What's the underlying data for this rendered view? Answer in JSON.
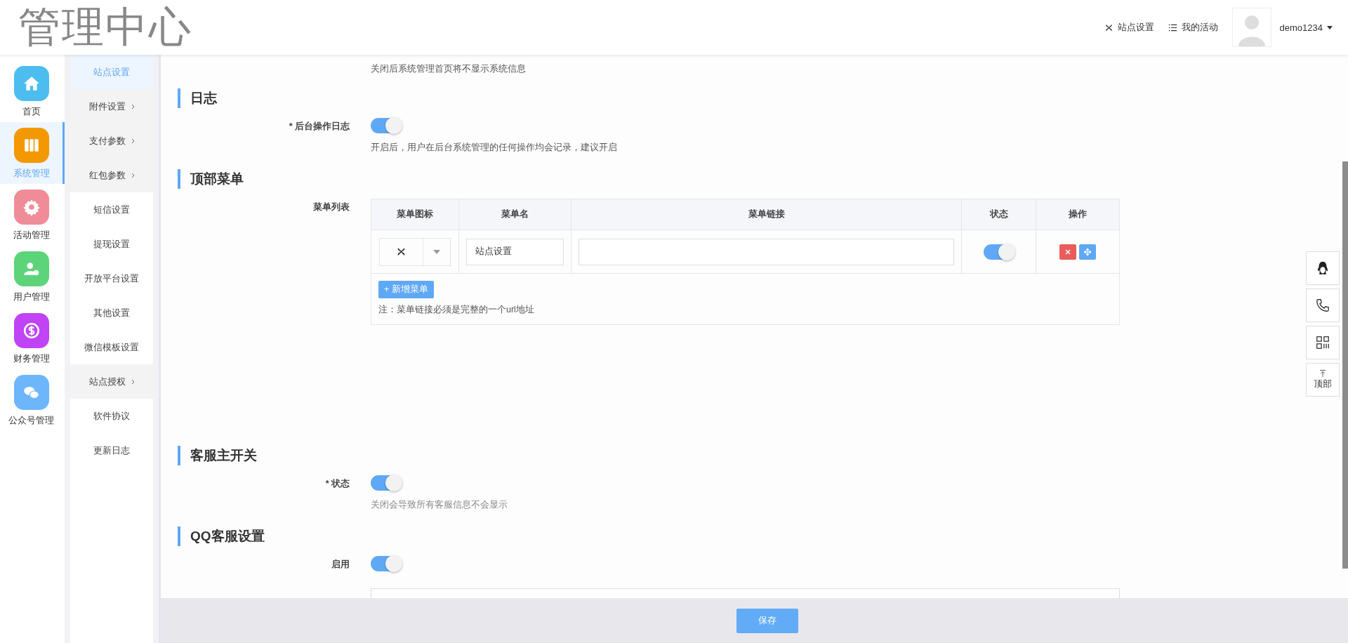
{
  "header": {
    "logo": "管理中心",
    "links": [
      {
        "label": "站点设置"
      },
      {
        "label": "我的活动"
      }
    ],
    "user": "demo1234"
  },
  "nav": [
    {
      "label": "首页",
      "color": "#4dbdf0",
      "selected": false
    },
    {
      "label": "系统管理",
      "color": "#f39800",
      "selected": true
    },
    {
      "label": "活动管理",
      "color": "#f08c98",
      "selected": false
    },
    {
      "label": "用户管理",
      "color": "#5ed47a",
      "selected": false
    },
    {
      "label": "财务管理",
      "color": "#c043f5",
      "selected": false
    },
    {
      "label": "公众号管理",
      "color": "#6db6fb",
      "selected": false
    }
  ],
  "submenu": [
    {
      "label": "站点设置",
      "selected": true,
      "expandable": false
    },
    {
      "label": "附件设置",
      "selected": false,
      "expandable": true
    },
    {
      "label": "支付参数",
      "selected": false,
      "expandable": true
    },
    {
      "label": "红包参数",
      "selected": false,
      "expandable": true
    },
    {
      "label": "短信设置",
      "selected": false,
      "expandable": false
    },
    {
      "label": "提现设置",
      "selected": false,
      "expandable": false
    },
    {
      "label": "开放平台设置",
      "selected": false,
      "expandable": false
    },
    {
      "label": "其他设置",
      "selected": false,
      "expandable": false
    },
    {
      "label": "微信模板设置",
      "selected": false,
      "expandable": false
    },
    {
      "label": "站点授权",
      "selected": false,
      "expandable": true
    },
    {
      "label": "软件协议",
      "selected": false,
      "expandable": false
    },
    {
      "label": "更新日志",
      "selected": false,
      "expandable": false
    }
  ],
  "content": [
    {
      "kind": "note",
      "text": "关闭后系统管理首页将不显示系统信息"
    },
    {
      "kind": "heading",
      "text": "日志"
    },
    {
      "kind": "switch",
      "label": "* 后台操作日志",
      "on": true,
      "help": "开启后，用户在后台系统管理的任何操作均会记录，建议开启"
    },
    {
      "kind": "heading",
      "text": "顶部菜单"
    },
    {
      "kind": "table",
      "label": "菜单列表",
      "columns": [
        "菜单图标",
        "菜单名",
        "菜单链接",
        "状态",
        "操作"
      ],
      "rows": [
        {
          "name": "站点设置",
          "on": true
        }
      ],
      "add_button": "+ 新增菜单",
      "note": "注：菜单链接必须是完整的一个url地址"
    },
    {
      "kind": "spacer"
    },
    {
      "kind": "heading",
      "text": "客服主开关"
    },
    {
      "kind": "switch",
      "label": "* 状态",
      "on": true,
      "help": "关闭会导致所有客服信息不会显示"
    },
    {
      "kind": "heading",
      "text": "QQ客服设置"
    },
    {
      "kind": "switch",
      "label": "启用",
      "on": true
    },
    {
      "kind": "field"
    }
  ],
  "footer": {
    "save": "保存"
  },
  "float_buttons": [
    {
      "kind": "qq"
    },
    {
      "kind": "phone"
    },
    {
      "kind": "grid"
    },
    {
      "kind": "top",
      "label": "顶部"
    }
  ]
}
